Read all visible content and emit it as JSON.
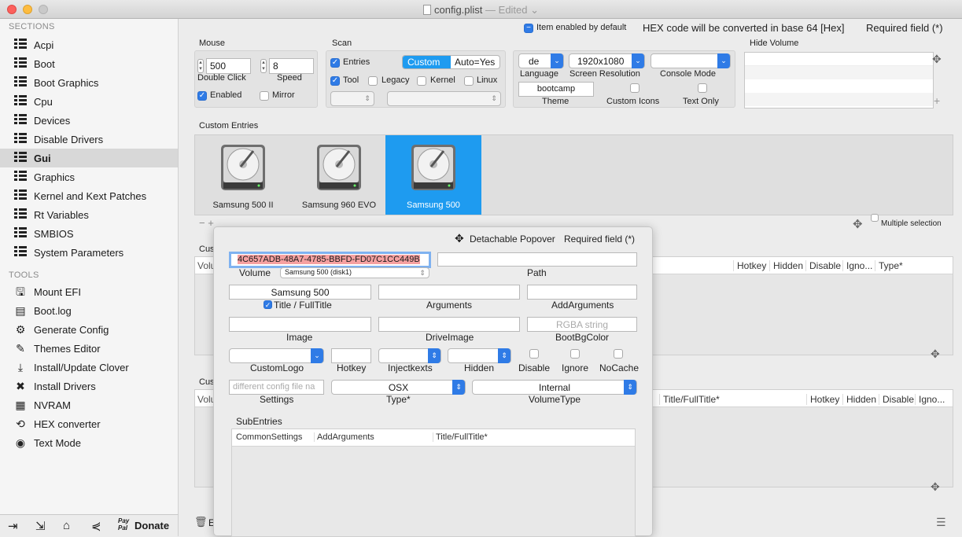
{
  "window": {
    "title": "config.plist",
    "edited": "— Edited ⌄"
  },
  "sidebar": {
    "sections_header": "SECTIONS",
    "sections": [
      "Acpi",
      "Boot",
      "Boot Graphics",
      "Cpu",
      "Devices",
      "Disable Drivers",
      "Gui",
      "Graphics",
      "Kernel and Kext Patches",
      "Rt Variables",
      "SMBIOS",
      "System Parameters"
    ],
    "selected": "Gui",
    "tools_header": "TOOLS",
    "tools": [
      "Mount EFI",
      "Boot.log",
      "Generate Config",
      "Themes Editor",
      "Install/Update Clover",
      "Install Drivers",
      "NVRAM",
      "HEX converter",
      "Text Mode"
    ],
    "donate": "Donate",
    "paypal": "Pay Pal"
  },
  "topbar": {
    "item_enabled": "Item enabled by default",
    "hex_note": "HEX code will be converted in base 64 [Hex]",
    "required": "Required field (*)"
  },
  "mouse": {
    "title": "Mouse",
    "double_click": "500",
    "double_click_label": "Double Click",
    "speed": "8",
    "speed_label": "Speed",
    "enabled": "Enabled",
    "mirror": "Mirror"
  },
  "scan": {
    "title": "Scan",
    "entries": "Entries",
    "tool": "Tool",
    "legacy": "Legacy",
    "kernel": "Kernel",
    "linux": "Linux",
    "custom": "Custom",
    "auto": "Auto=Yes"
  },
  "theme": {
    "language": "de",
    "language_label": "Language",
    "resolution": "1920x1080",
    "resolution_label": "Screen Resolution",
    "console_label": "Console Mode",
    "theme": "bootcamp",
    "theme_label": "Theme",
    "custom_icons": "Custom Icons",
    "text_only": "Text Only"
  },
  "hide_volume": {
    "title": "Hide Volume"
  },
  "custom_entries": {
    "title": "Custom Entries",
    "entries": [
      "Samsung 500 II",
      "Samsung 960 EVO",
      "Samsung 500"
    ],
    "multiple_selection": "Multiple selection"
  },
  "background_tables": {
    "t1_cols": [
      "Hotkey",
      "Hidden",
      "Disable",
      "Igno...",
      "Type*"
    ],
    "t2_cols": [
      "Title/FullTitle*",
      "Hotkey",
      "Hidden",
      "Disable",
      "Igno..."
    ],
    "cut_label1": "Cus",
    "cut_label2": "Cus",
    "vol1": "Volu",
    "vol2": "Volu",
    "e_label": "E"
  },
  "popover": {
    "detachable": "Detachable Popover",
    "required": "Required field (*)",
    "uuid": "4C657ADB-48A7-4785-BBFD-FD07C1CC449B",
    "volume_label": "Volume",
    "volume_value": "Samsung 500 (disk1)",
    "path_label": "Path",
    "title_value": "Samsung 500",
    "title_label": "Title / FullTitle",
    "arguments_label": "Arguments",
    "addarguments_label": "AddArguments",
    "image_label": "Image",
    "driveimage_label": "DriveImage",
    "bgcolor_placeholder": "RGBA string",
    "bgcolor_label": "BootBgColor",
    "customlogo_label": "CustomLogo",
    "hotkey_label": "Hotkey",
    "injectkexts_label": "Injectkexts",
    "hidden_label": "Hidden",
    "disable_label": "Disable",
    "ignore_label": "Ignore",
    "nocache_label": "NoCache",
    "settings_placeholder": "different config file na",
    "settings_label": "Settings",
    "type_value": "OSX",
    "type_label": "Type*",
    "voltype_value": "Internal",
    "voltype_label": "VolumeType",
    "subentries_title": "SubEntries",
    "sub_cols": [
      "CommonSettings",
      "AddArguments",
      "Title/FullTitle*"
    ]
  },
  "colors": {
    "accent": "#2f7be6",
    "selection": "#1e9bf0"
  }
}
